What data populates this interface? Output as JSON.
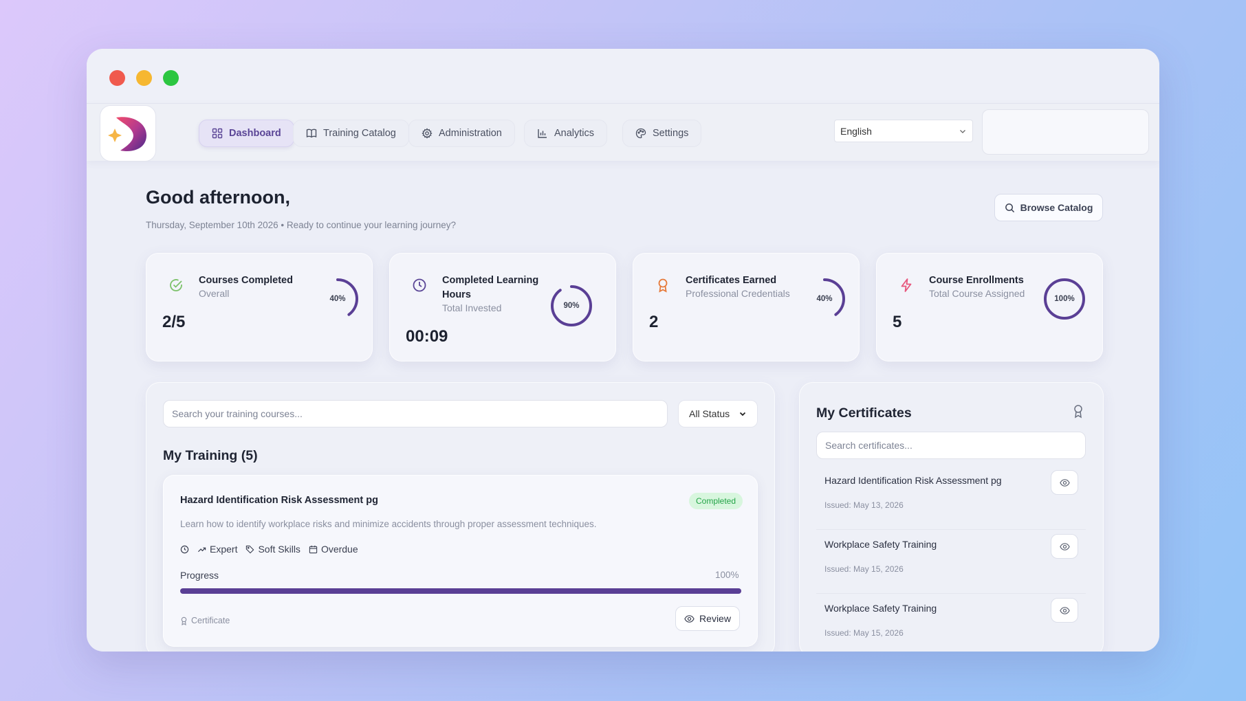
{
  "nav": {
    "tabs": [
      {
        "label": "Dashboard",
        "icon": "grid-icon",
        "active": true
      },
      {
        "label": "Training Catalog",
        "icon": "book-icon"
      },
      {
        "label": "Administration",
        "icon": "gear-icon"
      },
      {
        "label": "Analytics",
        "icon": "bar-chart-icon"
      },
      {
        "label": "Settings",
        "icon": "palette-icon"
      }
    ],
    "language": "English"
  },
  "header": {
    "greeting": "Good afternoon,",
    "subline": "Thursday, September 10th 2026 • Ready to continue your learning journey?",
    "browse_label": "Browse Catalog"
  },
  "stats": [
    {
      "title": "Courses Completed",
      "subtitle": "Overall",
      "value": "2/5",
      "ring_label": "40%",
      "ring_pct": 0.4,
      "icon": "check-circle-icon",
      "icon_color": "#7cc16a"
    },
    {
      "title": "Completed Learning Hours",
      "subtitle": "Total Invested",
      "value": "00:09",
      "ring_label": "90%",
      "ring_pct": 0.9,
      "icon": "clock-icon",
      "icon_color": "#5a4596"
    },
    {
      "title": "Certificates Earned",
      "subtitle": "Professional Credentials",
      "value": "2",
      "ring_label": "40%",
      "ring_pct": 0.4,
      "icon": "award-icon",
      "icon_color": "#e67a3a"
    },
    {
      "title": "Course Enrollments",
      "subtitle": "Total Course Assigned",
      "value": "5",
      "ring_label": "100%",
      "ring_pct": 1.0,
      "icon": "lightning-icon",
      "icon_color": "#e7577d"
    }
  ],
  "training": {
    "search_placeholder": "Search your training courses...",
    "status_filter": "All Status",
    "title": "My Training (5)",
    "course": {
      "title": "Hazard Identification Risk Assessment pg",
      "status": "Completed",
      "description": "Learn how to identify workplace risks and minimize accidents through proper assessment techniques.",
      "level": "Expert",
      "category": "Soft Skills",
      "due": "Overdue",
      "progress_label": "Progress",
      "progress_text": "100%",
      "progress_value": 1.0,
      "certificate_label": "Certificate",
      "review_label": "Review"
    }
  },
  "certificates": {
    "title": "My Certificates",
    "search_placeholder": "Search certificates...",
    "items": [
      {
        "name": "Hazard Identification Risk Assessment pg",
        "issued": "Issued: May 13, 2026"
      },
      {
        "name": "Workplace Safety Training",
        "issued": "Issued: May 15, 2026"
      },
      {
        "name": "Workplace Safety Training",
        "issued": "Issued: May 15, 2026"
      }
    ]
  },
  "colors": {
    "accent": "#5a3f95",
    "ring": "#5a3f95",
    "success": "#23a447"
  }
}
